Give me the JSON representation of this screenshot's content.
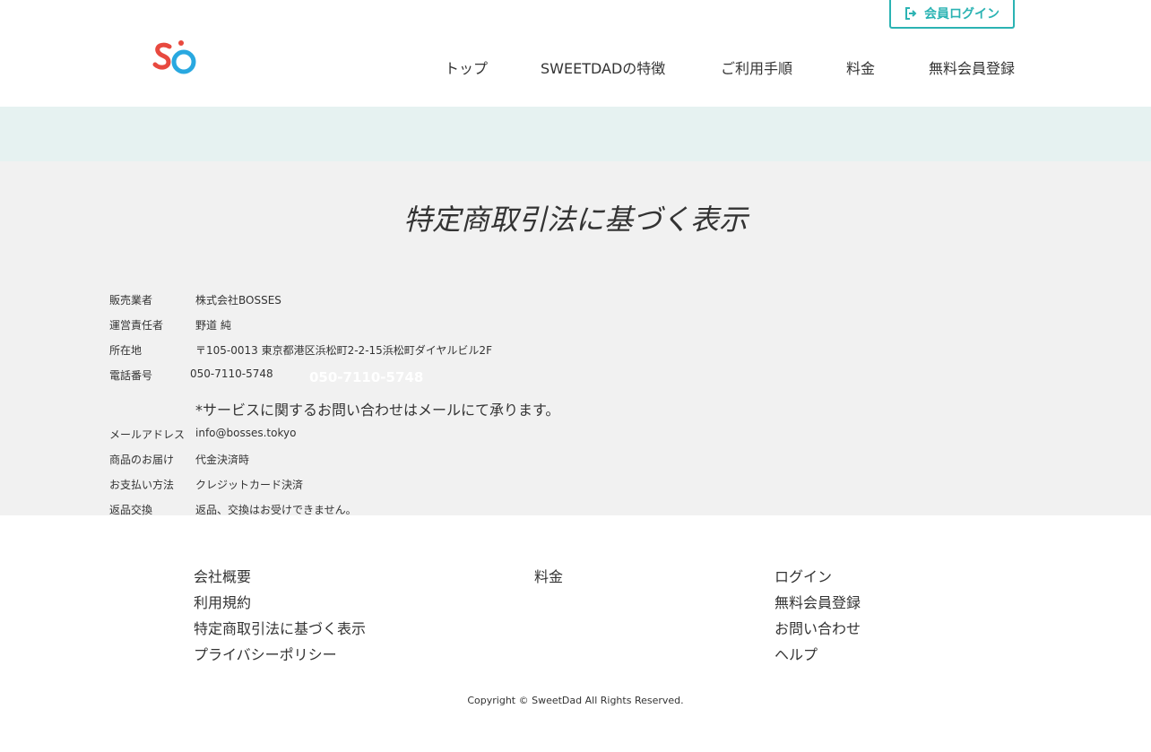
{
  "header": {
    "login_label": "会員ログイン",
    "logo_text": "SO",
    "nav": [
      {
        "label": "トップ"
      },
      {
        "label": "SWEETDADの特徴"
      },
      {
        "label": "ご利用手順"
      },
      {
        "label": "料金"
      },
      {
        "label": "無料会員登録"
      }
    ]
  },
  "main": {
    "title": "特定商取引法に基づく表示",
    "rows": [
      {
        "label": "販売業者",
        "value": "株式会社BOSSES"
      },
      {
        "label": "運営責任者",
        "value": "野道 純"
      },
      {
        "label": "所在地",
        "value": "〒105-0013 東京都港区浜松町2-2-15浜松町ダイヤルビル2F"
      },
      {
        "label": "電話番号",
        "value": "050-7110-5748"
      },
      {
        "label": "メールアドレス",
        "value": "info@bosses.tokyo"
      },
      {
        "label": "商品のお届け",
        "value": "代金決済時"
      },
      {
        "label": "お支払い方法",
        "value": "クレジットカード決済"
      },
      {
        "label": "返品交換",
        "value": "返品、交換はお受けできません。"
      }
    ],
    "phone_overlay": "050-7110-5748",
    "notice": "*サービスに関するお問い合わせはメールにて承ります。"
  },
  "footer": {
    "col1": [
      "会社概要",
      "利用規約",
      "特定商取引法に基づく表示",
      "プライバシーポリシー"
    ],
    "col2": [
      "料金"
    ],
    "col3": [
      "ログイン",
      "無料会員登録",
      "お問い合わせ",
      "ヘルプ"
    ],
    "copyright": "Copyright © SweetDad All Rights Reserved."
  },
  "colors": {
    "accent": "#2bb3b3",
    "band": "#e6f2f1",
    "content_bg": "#f1f1f1",
    "logo_red": "#e8493f",
    "logo_blue": "#29a8e0"
  }
}
